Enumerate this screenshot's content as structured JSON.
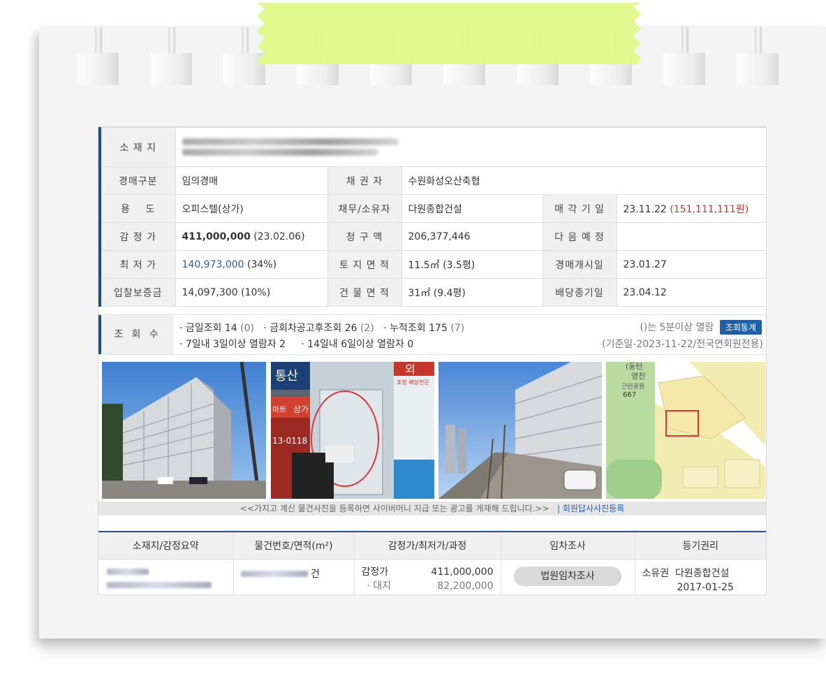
{
  "labels": {
    "location": "소 재 지",
    "auction_type": "경매구분",
    "creditor": "채 권 자",
    "usage": "용    도",
    "debtor_owner": "채무/소유자",
    "sale_date": "매 각 기 일",
    "appraisal": "감 정 가",
    "claim": "청 구 액",
    "next_schedule": "다 음 예 정",
    "min_price": "최 저 가",
    "land_area": "토 지 면 적",
    "start_date": "경매개시일",
    "deposit": "입찰보증금",
    "building_area": "건 물 면 적",
    "dividend_date": "배당종기일",
    "views": "조 회 수"
  },
  "values": {
    "auction_type": "임의경매",
    "creditor": "수원화성오산축협",
    "usage": "오피스텔(상가)",
    "debtor_owner": "다원종합건설",
    "sale_date": "23.11.22",
    "sale_price": "(151,111,111원)",
    "appraisal": "411,000,000",
    "appraisal_date": "(23.02.06)",
    "claim": "206,377,446",
    "next_schedule": "",
    "min_price": "140,973,000",
    "min_ratio": "(34%)",
    "land_area": "11.5㎡ (3.5평)",
    "start_date": "23.01.27",
    "deposit": "14,097,300 (10%)",
    "building_area": "31㎡ (9.4평)",
    "dividend_date": "23.04.12"
  },
  "views": {
    "today_label": "· 금일조회",
    "today_count": "14",
    "today_sub": "(0)",
    "after_label": "· 금회차공고후조회",
    "after_count": "26",
    "after_sub": "(2)",
    "total_label": "· 누적조회",
    "total_count": "175",
    "total_sub": "(7)",
    "week_label": "· 7일내 3일이상 열람자",
    "week_count": "2",
    "twoweek_label": "· 14일내 6일이상 열람자",
    "twoweek_count": "0",
    "note": "()는 5분이상 열람",
    "stats_button": "조회통계",
    "basis": "(기준일-2023-11-22/전국연회원전용)"
  },
  "photos": {
    "caption": "<<가지고 계신 물건사진을 등록하면 사이버머니 지급 또는 광고를 게재해 드립니다.>>",
    "register_link": "| 회원답사사진등록",
    "sign1": "통산",
    "sign2": "상가",
    "sign3": "마트",
    "sign4": "13-0118",
    "sign5": "외",
    "sign6": "포항 배당전문",
    "map_label1": "(동탄",
    "map_label2": "영천",
    "map_label3": "근린공원",
    "map_label4": "667"
  },
  "list": {
    "headers": [
      "소재지/감정요약",
      "물건번호/면적(m²)",
      "감정가/최저가/과정",
      "임차조사",
      "등기권리"
    ],
    "item_suffix": "건",
    "appraisal_label": "감정가",
    "appraisal_value": "411,000,000",
    "land_label": "· 대지",
    "land_value": "82,200,000",
    "court_button": "법원임차조사",
    "right_type": "소유권",
    "right_holder": "다원종합건설",
    "right_date": "2017-01-25"
  }
}
